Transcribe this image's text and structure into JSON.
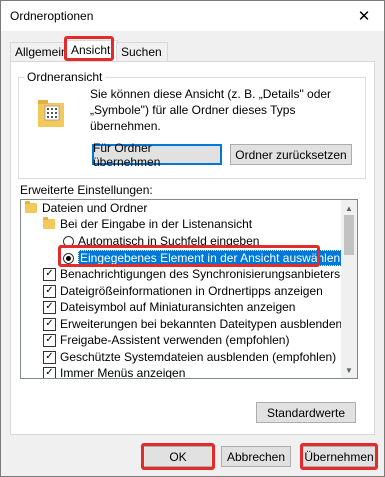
{
  "window": {
    "title": "Ordneroptionen",
    "close_glyph": "✕"
  },
  "tabs": [
    {
      "label": "Allgemein"
    },
    {
      "label": "Ansicht",
      "active": true
    },
    {
      "label": "Suchen"
    }
  ],
  "folder_view": {
    "group_label": "Ordneransicht",
    "description": "Sie können diese Ansicht (z. B. „Details\" oder „Symbole\") für alle Ordner dieses Typs übernehmen.",
    "apply_button": "Für Ordner übernehmen",
    "reset_button": "Ordner zurücksetzen"
  },
  "advanced": {
    "label": "Erweiterte Einstellungen:",
    "items": [
      {
        "type": "folder",
        "label": "Dateien und Ordner"
      },
      {
        "type": "folder",
        "label": "Bei der Eingabe in der Listenansicht"
      },
      {
        "type": "radio",
        "label": "Automatisch in Suchfeld eingeben",
        "checked": false
      },
      {
        "type": "radio",
        "label": "Eingegebenes Element in der Ansicht auswählen",
        "checked": true
      },
      {
        "type": "checkbox",
        "label": "Benachrichtigungen des Synchronisierungsanbieters anzeig",
        "checked": true
      },
      {
        "type": "checkbox",
        "label": "Dateigrößeinformationen in Ordnertipps anzeigen",
        "checked": true
      },
      {
        "type": "checkbox",
        "label": "Dateisymbol auf Miniaturansichten anzeigen",
        "checked": true
      },
      {
        "type": "checkbox",
        "label": "Erweiterungen bei bekannten Dateitypen ausblenden",
        "checked": true
      },
      {
        "type": "checkbox",
        "label": "Freigabe-Assistent verwenden (empfohlen)",
        "checked": true
      },
      {
        "type": "checkbox",
        "label": "Geschützte Systemdateien ausblenden (empfohlen)",
        "checked": true
      },
      {
        "type": "checkbox",
        "label": "Immer Menüs anzeigen",
        "checked": true
      }
    ],
    "defaults_button": "Standardwerte"
  },
  "footer": {
    "ok": "OK",
    "cancel": "Abbrechen",
    "apply": "Übernehmen"
  },
  "colors": {
    "highlight": "#e32b2b",
    "selection": "#0078d7",
    "folder": "#f3c95c"
  }
}
